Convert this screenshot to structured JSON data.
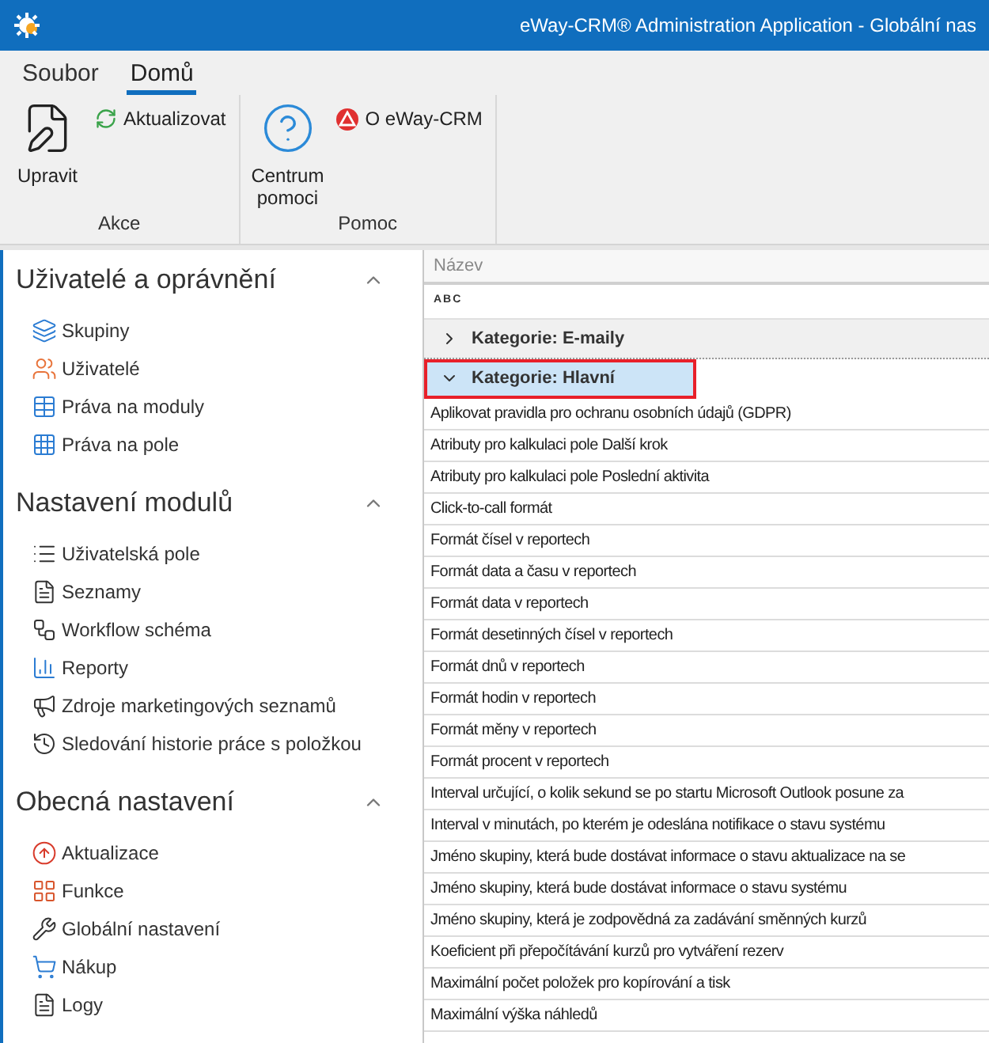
{
  "window": {
    "title": "eWay-CRM® Administration Application - Globální nas"
  },
  "ribbon": {
    "tabs": [
      {
        "label": "Soubor",
        "selected": false
      },
      {
        "label": "Domů",
        "selected": true
      }
    ],
    "groups": [
      {
        "label": "Akce",
        "large": "Upravit",
        "small": "Aktualizovat"
      },
      {
        "label": "Pomoc",
        "large": "Centrum pomoci",
        "small": "O eWay-CRM"
      }
    ]
  },
  "sidebar": {
    "sections": [
      {
        "title": "Uživatelé a oprávnění",
        "expanded": true,
        "items": [
          "Skupiny",
          "Uživatelé",
          "Práva na moduly",
          "Práva na pole"
        ]
      },
      {
        "title": "Nastavení modulů",
        "expanded": true,
        "items": [
          "Uživatelská pole",
          "Seznamy",
          "Workflow schéma",
          "Reporty",
          "Zdroje marketingových seznamů",
          "Sledování historie práce s položkou"
        ]
      },
      {
        "title": "Obecná nastavení",
        "expanded": true,
        "items": [
          "Aktualizace",
          "Funkce",
          "Globální nastavení",
          "Nákup",
          "Logy"
        ]
      }
    ]
  },
  "grid": {
    "column": "Název",
    "filter_icon": "ABC",
    "groups": [
      {
        "label": "Kategorie: E-maily",
        "expanded": false,
        "selected": false
      },
      {
        "label": "Kategorie: Hlavní",
        "expanded": true,
        "selected": true,
        "rows": [
          "Aplikovat pravidla pro ochranu osobních údajů (GDPR)",
          "Atributy pro kalkulaci pole Další krok",
          "Atributy pro kalkulaci pole Poslední aktivita",
          "Click-to-call formát",
          "Formát čísel v reportech",
          "Formát data a času v reportech",
          "Formát data v reportech",
          "Formát desetinných čísel v reportech",
          "Formát dnů v reportech",
          "Formát hodin v reportech",
          "Formát měny v reportech",
          "Formát procent v reportech",
          "Interval určující, o kolik sekund se po startu Microsoft Outlook posune za",
          "Interval v minutách, po kterém je odeslána notifikace o stavu systému",
          "Jméno skupiny, která bude dostávat informace o stavu aktualizace na se",
          "Jméno skupiny, která bude dostávat informace o stavu systému",
          "Jméno skupiny, která je zodpovědná za zadávání směnných kurzů",
          "Koeficient při přepočítávání kurzů pro vytváření rezerv",
          "Maximální počet položek pro kopírování a tisk",
          "Maximální výška náhledů"
        ]
      }
    ]
  }
}
